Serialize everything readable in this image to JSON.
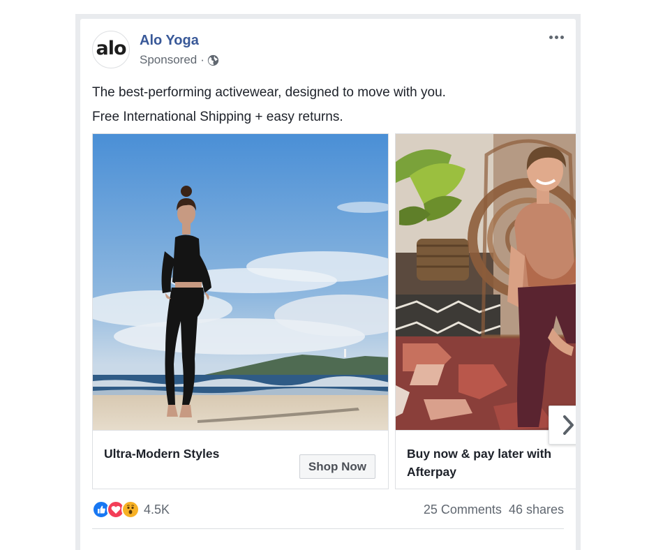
{
  "post": {
    "page_name": "Alo Yoga",
    "avatar_text": "alo",
    "sponsored": "Sponsored",
    "separator": "·",
    "privacy_icon": "globe-icon",
    "more_icon": "more-options-icon",
    "text_lines": [
      "The best-performing activewear, designed to move with you.",
      "Free International Shipping + easy returns."
    ]
  },
  "carousel": {
    "items": [
      {
        "title": "Ultra-Modern Styles",
        "cta": "Shop Now",
        "image": "woman in black activewear on beach"
      },
      {
        "title": "Buy now & pay later with Afterpay",
        "image": "smiling woman in wicker chair"
      }
    ],
    "next_icon": "chevron-right-icon"
  },
  "footer": {
    "reactions": [
      "like-icon",
      "love-icon",
      "wow-icon"
    ],
    "reaction_count": "4.5K",
    "comments": "25 Comments",
    "shares": "46 shares"
  },
  "colors": {
    "link": "#385898",
    "secondary_text": "#606770",
    "like": "#1877f2",
    "love": "#f33e58",
    "wow": "#f7b125"
  }
}
